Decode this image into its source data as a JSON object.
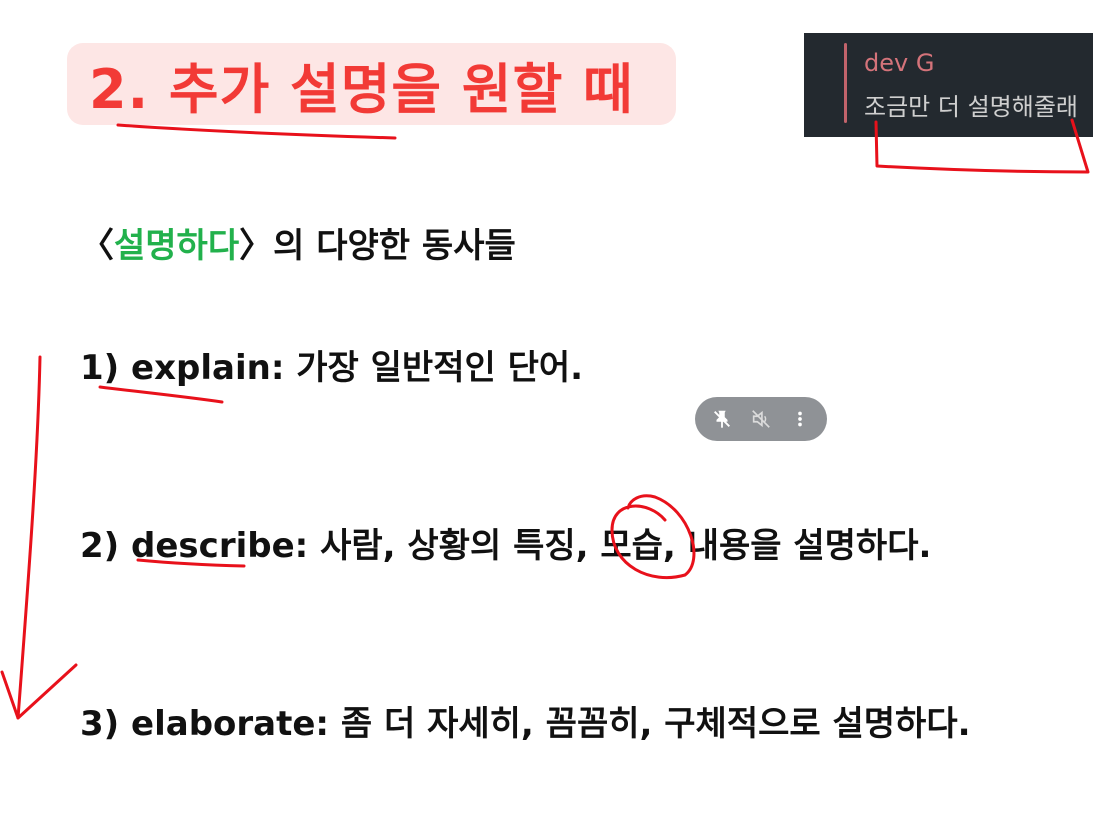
{
  "title": "2. 추가 설명을 원할 때",
  "chat": {
    "user": "dev G",
    "message": "조금만 더 설명해줄래"
  },
  "subtitle": {
    "prefix": "〈",
    "highlight": "설명하다",
    "suffix": "〉의 다양한 동사들"
  },
  "items": [
    {
      "label": "1) explain: 가장 일반적인 단어."
    },
    {
      "label": "2) describe: 사람, 상황의 특징, 모습, 내용을 설명하다."
    },
    {
      "label": "3) elaborate: 좀 더 자세히, 꼼꼼히, 구체적으로 설명하다."
    }
  ],
  "media_controls": {
    "icons": [
      "unpin-icon",
      "volume-muted-icon",
      "more-options-icon"
    ]
  },
  "colors": {
    "title": "#f23a36",
    "title_bg": "#fde6e5",
    "highlight": "#22b14c",
    "ink": "#e8111b",
    "chat_bg": "#23292f"
  }
}
